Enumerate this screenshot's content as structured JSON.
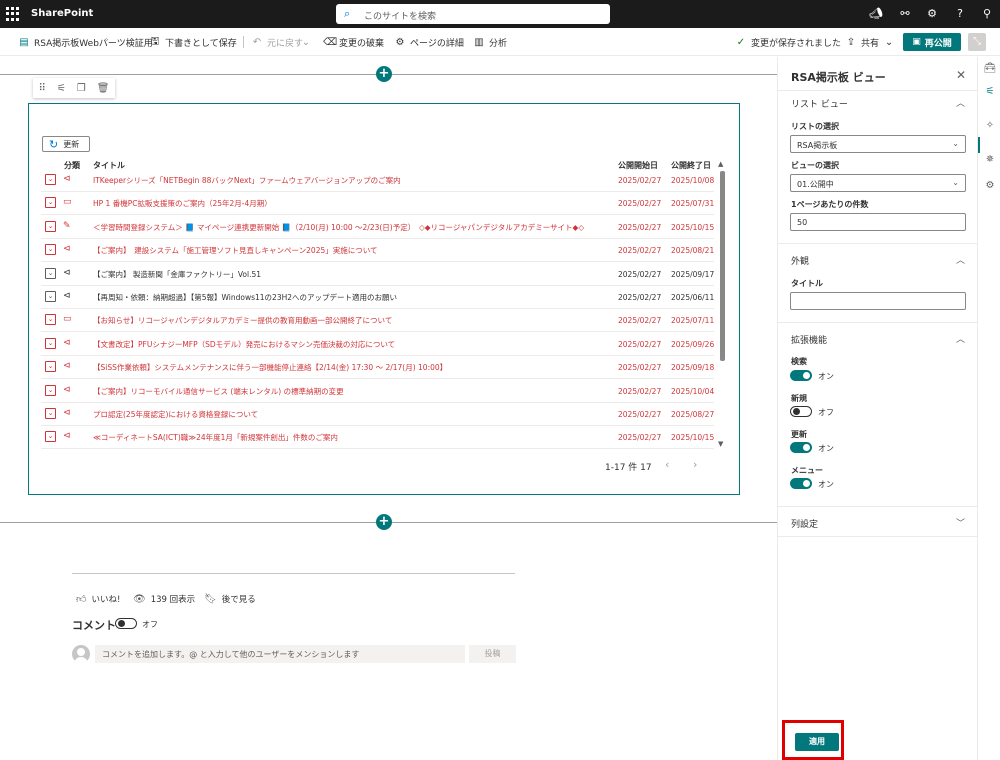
{
  "suite": {
    "brand": "SharePoint",
    "search_placeholder": "このサイトを検索",
    "icons": [
      "megaphone-icon",
      "share-network-icon",
      "settings-icon",
      "help-icon",
      "account-icon"
    ]
  },
  "commandbar": {
    "page_name": "RSA掲示板Webパーツ検証用",
    "save_draft": "下書きとして保存",
    "undo": "元に戻す",
    "discard": "変更の破棄",
    "page_details": "ページの詳細",
    "analytics": "分析",
    "saved_status": "変更が保存されました",
    "share": "共有",
    "republish": "再公開"
  },
  "webpart": {
    "refresh_label": "更新",
    "columns": {
      "category": "分類",
      "title": "タイトル",
      "start": "公開開始日",
      "end": "公開終了日"
    },
    "rows": [
      {
        "title": "ITKeeperシリーズ「NETBegin 88バックNext」ファームウェアバージョンアップのご案内",
        "start": "2025/02/27",
        "end": "2025/10/08",
        "color": "red",
        "icon": "megaphone-icon"
      },
      {
        "title": "HP 1 番機PC拡販支援策のご案内（25年2月-4月期）",
        "start": "2025/02/27",
        "end": "2025/07/31",
        "color": "red",
        "icon": "monitor-icon"
      },
      {
        "title": "＜学習時間登録システム＞ 📘 マイページ連携更新開始 📘（2/10(月) 10:00 ～2/23(日)予定）　◇◆リコージャパンデジタルアカデミーサイト◆◇",
        "start": "2025/02/27",
        "end": "2025/10/15",
        "color": "red",
        "icon": "edit-icon"
      },
      {
        "title": "【ご案内】　建設システム「施工管理ソフト見直しキャンペーン2025」実施について",
        "start": "2025/02/27",
        "end": "2025/08/21",
        "color": "red",
        "icon": "megaphone-icon"
      },
      {
        "title": "【ご案内】 製造新聞「金庫ファクトリー」Vol.51",
        "start": "2025/02/27",
        "end": "2025/09/17",
        "color": "black",
        "icon": "megaphone-icon"
      },
      {
        "title": "【再周知・依頼：納期超過】【第5報】Windows11の23H2へのアップデート適用のお願い",
        "start": "2025/02/27",
        "end": "2025/06/11",
        "color": "black",
        "icon": "megaphone-icon"
      },
      {
        "title": "【お知らせ】リコージャパンデジタルアカデミー提供の教育用動画一部公開終了について",
        "start": "2025/02/27",
        "end": "2025/07/11",
        "color": "red",
        "icon": "monitor-icon"
      },
      {
        "title": "【文書改定】PFUシナジーMFP（SDモデル）発売におけるマシン売価決裁の対応について",
        "start": "2025/02/27",
        "end": "2025/09/26",
        "color": "red",
        "icon": "megaphone-icon"
      },
      {
        "title": "【SiSS作業依頼】システムメンテナンスに伴う一部機能停止連絡【2/14(金) 17:30 ～ 2/17(月) 10:00】",
        "start": "2025/02/27",
        "end": "2025/09/18",
        "color": "red",
        "icon": "megaphone-icon"
      },
      {
        "title": "【ご案内】リコーモバイル通信サービス (端末レンタル) の標準納期の変更",
        "start": "2025/02/27",
        "end": "2025/10/04",
        "color": "red",
        "icon": "megaphone-icon"
      },
      {
        "title": "プロ認定(25年度認定)における資格登録について",
        "start": "2025/02/27",
        "end": "2025/08/27",
        "color": "red",
        "icon": "megaphone-icon"
      },
      {
        "title": "≪コーディネートSA(ICT)職≫24年度1月「新規案件創出」件数のご案内",
        "start": "2025/02/27",
        "end": "2025/10/15",
        "color": "red",
        "icon": "megaphone-icon"
      }
    ],
    "pager_text": "1-17 件 17"
  },
  "social": {
    "like": "いいね!",
    "views": "139 回表示",
    "save_later": "後で見る",
    "comments_heading": "コメント",
    "comments_toggle": "オフ",
    "comment_placeholder": "コメントを追加します。@ と入力して他のユーザーをメンションします",
    "post": "投稿"
  },
  "pane": {
    "title": "RSA掲示板 ビュー",
    "list_view_section": "リスト ビュー",
    "list_select_label": "リストの選択",
    "list_select_value": "RSA掲示板",
    "view_select_label": "ビューの選択",
    "view_select_value": "01.公開中",
    "per_page_label": "1ページあたりの件数",
    "per_page_value": "50",
    "appearance_section": "外観",
    "title_label": "タイトル",
    "title_value": "",
    "extensions_section": "拡張機能",
    "search_label": "検索",
    "search_state": "オン",
    "new_label": "新規",
    "new_state": "オフ",
    "refresh_label": "更新",
    "refresh_state": "オン",
    "menu_label": "メニュー",
    "menu_state": "オン",
    "column_settings_section": "列設定",
    "apply": "適用"
  },
  "colors": {
    "accent": "#03787c",
    "alert": "#d13438",
    "highlight": "#e00000"
  }
}
